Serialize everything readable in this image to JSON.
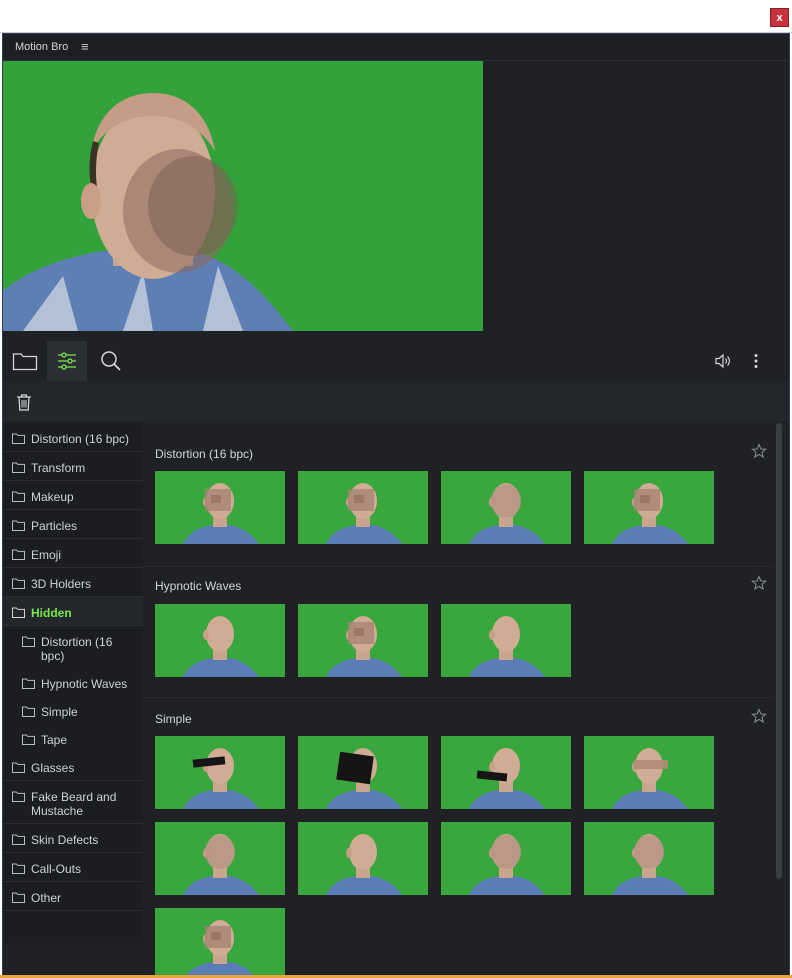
{
  "window": {
    "close_label": "x"
  },
  "panel": {
    "title": "Motion Bro",
    "menu_glyph": "≡"
  },
  "colors": {
    "accent_green": "#7be84d",
    "panel_bg": "#1f2124",
    "close_red": "#c8323a",
    "chroma_green": "#35a03a"
  },
  "toolbar": {
    "icons": [
      "folder-icon",
      "sliders-icon",
      "search-icon",
      "speaker-icon",
      "more-vertical-icon"
    ],
    "active": "sliders-icon"
  },
  "sidebar": {
    "items": [
      {
        "label": "Distortion (16 bpc)"
      },
      {
        "label": "Transform"
      },
      {
        "label": "Makeup"
      },
      {
        "label": "Particles"
      },
      {
        "label": "Emoji"
      },
      {
        "label": "3D Holders"
      },
      {
        "label": "Hidden",
        "active": true
      },
      {
        "label": "Distortion (16 bpc)",
        "sub": true
      },
      {
        "label": "Hypnotic Waves",
        "sub": true
      },
      {
        "label": "Simple",
        "sub": true
      },
      {
        "label": "Tape",
        "sub": true
      },
      {
        "label": "Glasses"
      },
      {
        "label": "Fake Beard and Mustache"
      },
      {
        "label": "Skin Defects"
      },
      {
        "label": "Call-Outs"
      },
      {
        "label": "Other"
      }
    ]
  },
  "sections": [
    {
      "title": "Distortion (16 bpc)",
      "thumb_count": 4
    },
    {
      "title": "Hypnotic Waves",
      "thumb_count": 3
    },
    {
      "title": "Simple",
      "thumb_count": 9
    }
  ]
}
